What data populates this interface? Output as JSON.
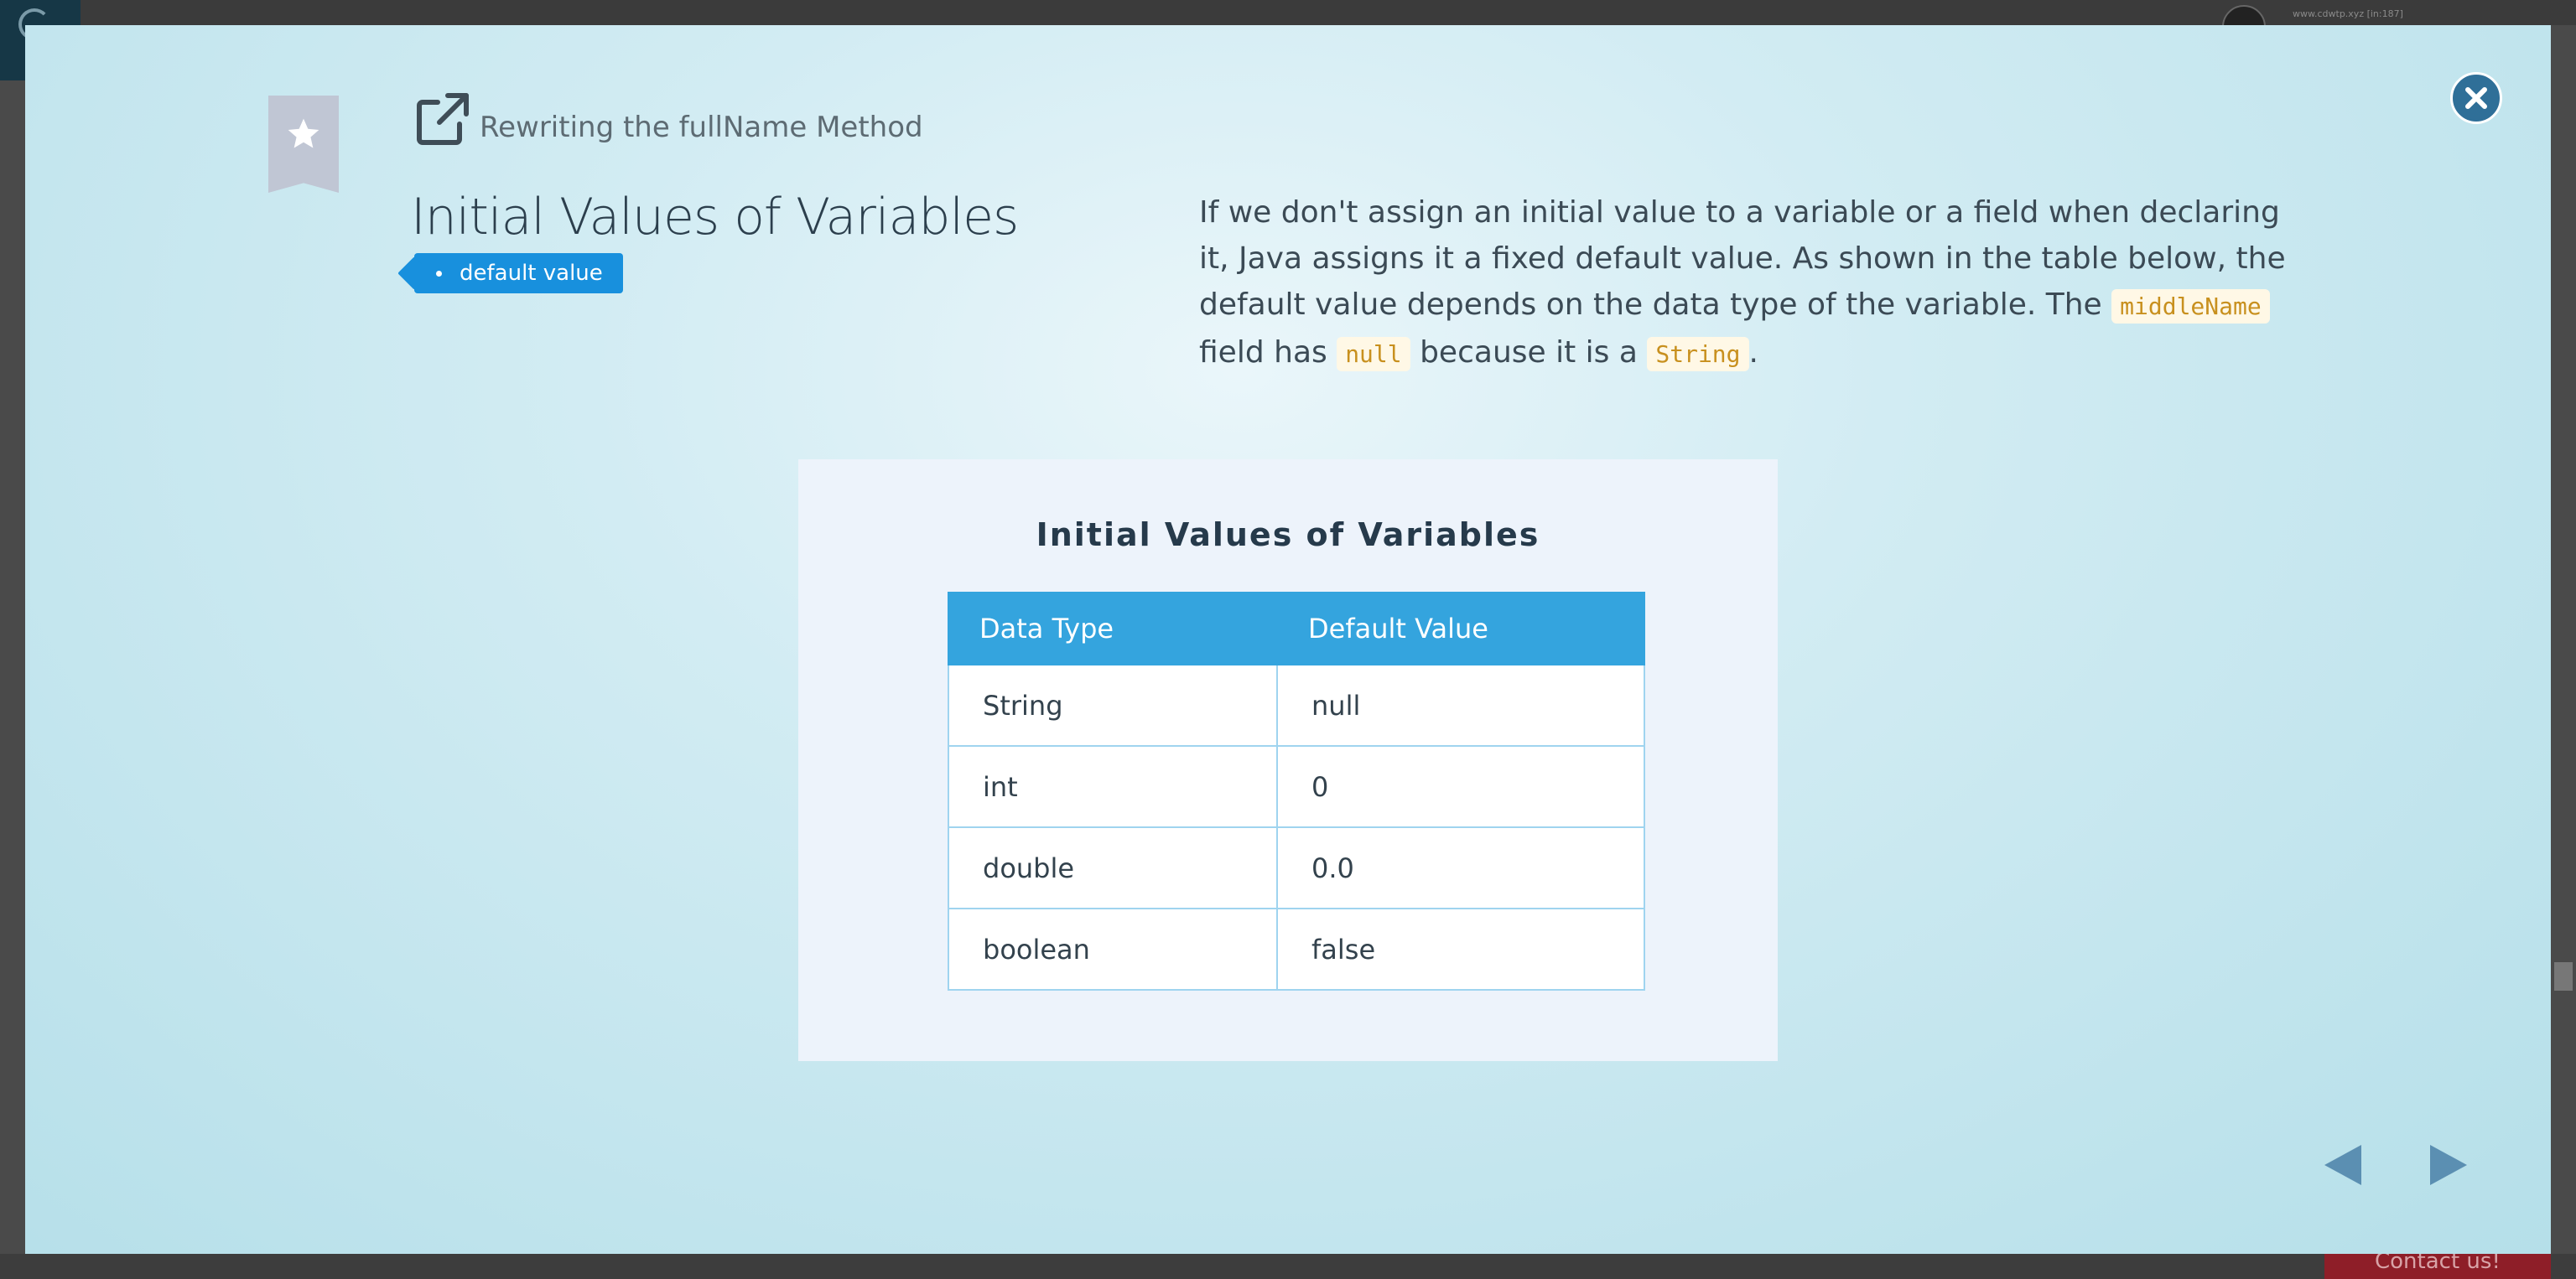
{
  "background": {
    "url_text": "www.cdwtp.xyz [in:187]",
    "contact_label": "Contact us!"
  },
  "modal": {
    "breadcrumb": "Rewriting the fullName Method",
    "title": "Initial Values of Variables",
    "tag": "default value",
    "description": {
      "part1": "If we don't assign an initial value to a variable or a field when declaring it, Java assigns it a fixed default value. As shown in the table below, the default value depends on the data type of the variable. The ",
      "code1": "middleName",
      "part2": " field has ",
      "code2": "null",
      "part3": " because it is a ",
      "code3": "String",
      "part4": "."
    },
    "figure": {
      "title": "Initial Values of Variables",
      "columns": [
        "Data Type",
        "Default Value"
      ],
      "rows": [
        [
          "String",
          "null"
        ],
        [
          "int",
          "0"
        ],
        [
          "double",
          "0.0"
        ],
        [
          "boolean",
          "false"
        ]
      ]
    }
  },
  "icons": {
    "close": "close-icon",
    "bookmark": "star-icon",
    "external_link": "external-link-icon",
    "prev": "triangle-left-icon",
    "next": "triangle-right-icon"
  },
  "colors": {
    "accent": "#1890dd",
    "table_header": "#34a4de",
    "close_button": "#2f6f98",
    "code_text": "#c8901e"
  }
}
